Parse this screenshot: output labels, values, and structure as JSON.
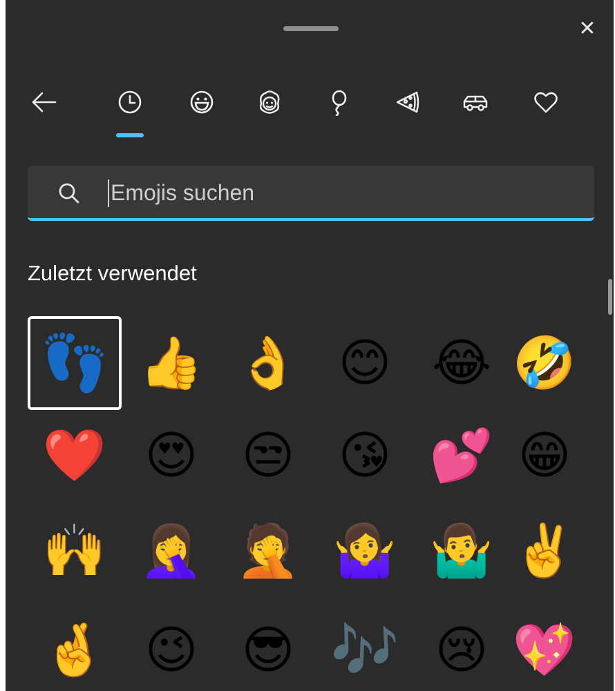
{
  "window": {
    "close_label": "✕"
  },
  "categories": [
    {
      "name": "back",
      "icon": "arrow-left-icon"
    },
    {
      "name": "recent",
      "icon": "clock-icon",
      "selected": true
    },
    {
      "name": "smileys",
      "icon": "smiley-icon"
    },
    {
      "name": "people",
      "icon": "person-face-icon"
    },
    {
      "name": "celebration",
      "icon": "balloon-icon"
    },
    {
      "name": "food",
      "icon": "pizza-icon"
    },
    {
      "name": "travel",
      "icon": "car-icon"
    },
    {
      "name": "symbols",
      "icon": "heart-outline-icon"
    }
  ],
  "search": {
    "placeholder": "Emojis suchen",
    "value": ""
  },
  "section": {
    "title": "Zuletzt verwendet"
  },
  "colors": {
    "accent": "#4cc2ff",
    "panel_bg": "#2b2b2b",
    "search_bg": "#383838"
  },
  "emojis": [
    "👣",
    "👍",
    "👌",
    "😊",
    "😂",
    "🤣",
    "❤️",
    "😍",
    "😒",
    "😘",
    "💕",
    "😁",
    "🙌",
    "🤦‍♀️",
    "🤦",
    "🤷‍♀️",
    "🤷‍♂️",
    "✌️",
    "🤞",
    "😉",
    "😎",
    "🎶",
    "😢",
    "💖"
  ]
}
